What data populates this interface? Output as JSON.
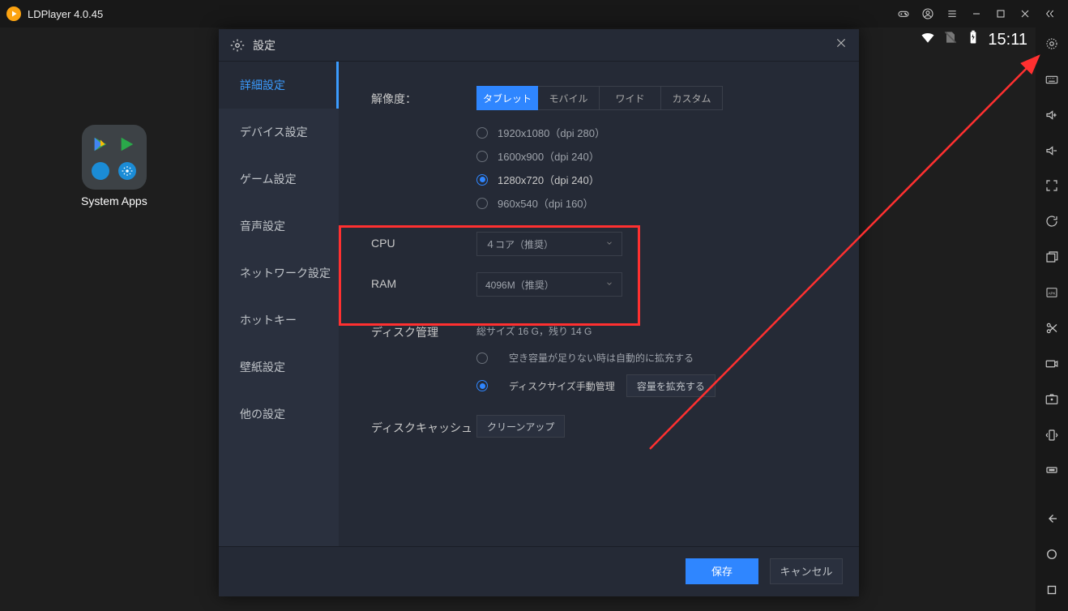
{
  "titlebar": {
    "title": "LDPlayer 4.0.45"
  },
  "statusbar": {
    "time": "15:11"
  },
  "desktop": {
    "systemAppsLabel": "System Apps"
  },
  "dialog": {
    "title": "設定",
    "nav": {
      "advanced": "詳細設定",
      "device": "デバイス設定",
      "game": "ゲーム設定",
      "audio": "音声設定",
      "network": "ネットワーク設定",
      "hotkey": "ホットキー",
      "wallpaper": "壁紙設定",
      "other": "他の設定"
    },
    "resolution": {
      "label": "解像度：",
      "tabs": {
        "tablet": "タブレット",
        "mobile": "モバイル",
        "wide": "ワイド",
        "custom": "カスタム"
      },
      "options": {
        "r1080": "1920x1080（dpi 280）",
        "r900": "1600x900（dpi 240）",
        "r720": "1280x720（dpi 240）",
        "r540": "960x540（dpi 160）"
      }
    },
    "cpu": {
      "label": "CPU",
      "value": "４コア（推奨）"
    },
    "ram": {
      "label": "RAM",
      "value": "4096M（推奨）"
    },
    "disk": {
      "label": "ディスク管理",
      "status": "総サイズ 16 G，残り 14 G",
      "autoExpand": "空き容量が足りない時は自動的に拡充する",
      "manual": "ディスクサイズ手動管理",
      "expandBtn": "容量を拡充する"
    },
    "cache": {
      "label": "ディスクキャッシュ",
      "btn": "クリーンアップ"
    },
    "footer": {
      "save": "保存",
      "cancel": "キャンセル"
    }
  }
}
